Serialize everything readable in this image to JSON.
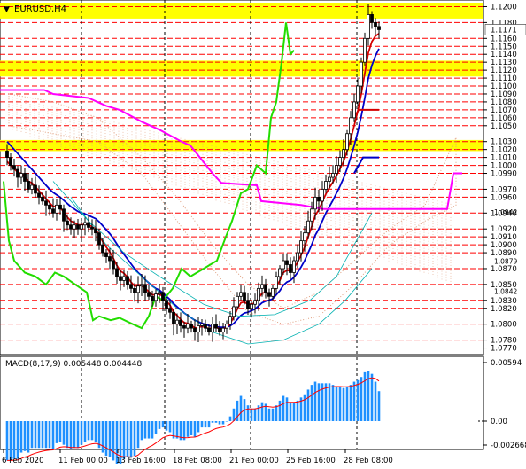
{
  "symbol_label": "EURUSD,H4",
  "macd_label": "MACD(8,17,9) 0.005448 0.004448",
  "colors": {
    "zone": "#ffff00",
    "level_line": "#ff0000",
    "candle": "#000000",
    "ma_red": "#d40000",
    "ma_blue": "#0000c8",
    "ma_magenta": "#ff00ff",
    "green_line": "#22dd00",
    "cyan": "#00b0b0",
    "ichimoku_cloud": "#e0a080",
    "macd_hist": "#1e90ff",
    "macd_signal": "#ff0000"
  },
  "chart_data": {
    "type": "candlestick",
    "symbol": "EURUSD",
    "timeframe": "H4",
    "ylim": [
      1.0765,
      1.1205
    ],
    "y_ticks": [
      "1.1200",
      "1.1180",
      "1.1160",
      "1.1150",
      "1.1140",
      "1.1130",
      "1.1120",
      "1.1110",
      "1.1100",
      "1.1090",
      "1.1080",
      "1.1070",
      "1.1060",
      "1.1050",
      "1.1030",
      "1.1020",
      "1.1010",
      "1.1000",
      "1.0990",
      "1.0970",
      "1.0960",
      "1.0940",
      "1.0920",
      "1.0910",
      "1.0900",
      "1.0890",
      "1.0870",
      "1.0850",
      "1.0830",
      "1.0820",
      "1.0800",
      "1.0780",
      "1.0770"
    ],
    "small_tick_labels": [
      "1.0879",
      "1.0942",
      "1.0842"
    ],
    "current_price": "1.1171",
    "x_labels": [
      "6 Feb 2020",
      "11 Feb 00:00",
      "13 Feb 16:00",
      "18 Feb 08:00",
      "21 Feb 00:00",
      "25 Feb 16:00",
      "28 Feb 08:00"
    ],
    "zones": [
      [
        1.1185,
        1.1205
      ],
      [
        1.1112,
        1.1132
      ],
      [
        1.1018,
        1.1032
      ]
    ],
    "levels": [
      1.12,
      1.118,
      1.116,
      1.115,
      1.114,
      1.113,
      1.112,
      1.111,
      1.11,
      1.109,
      1.108,
      1.107,
      1.106,
      1.105,
      1.103,
      1.102,
      1.101,
      1.1,
      1.099,
      1.097,
      1.096,
      1.094,
      1.092,
      1.091,
      1.09,
      1.089,
      1.087,
      1.085,
      1.083,
      1.082,
      1.08,
      1.078,
      1.077
    ],
    "closes": [
      1.101,
      1.1,
      1.0995,
      1.0985,
      1.099,
      1.098,
      1.097,
      1.0975,
      1.0965,
      1.096,
      1.0955,
      1.095,
      1.0945,
      1.094,
      1.095,
      1.0945,
      1.093,
      1.0925,
      1.092,
      1.0925,
      1.092,
      1.0925,
      1.0928,
      1.0922,
      1.092,
      1.0915,
      1.09,
      1.089,
      1.0885,
      1.088,
      1.087,
      1.086,
      1.0855,
      1.086,
      1.085,
      1.0845,
      1.084,
      1.0848,
      1.085,
      1.084,
      1.0835,
      1.083,
      1.0838,
      1.084,
      1.083,
      1.082,
      1.0815,
      1.08,
      1.0805,
      1.0798,
      1.0795,
      1.08,
      1.0795,
      1.079,
      1.0798,
      1.08,
      1.0795,
      1.079,
      1.08,
      1.0795,
      1.079,
      1.0795,
      1.08,
      1.081,
      1.0822,
      1.0835,
      1.084,
      1.083,
      1.082,
      1.0825,
      1.083,
      1.0845,
      1.085,
      1.084,
      1.0835,
      1.0845,
      1.086,
      1.087,
      1.088,
      1.0875,
      1.0865,
      1.088,
      1.089,
      1.0905,
      1.0915,
      1.093,
      1.0945,
      1.096,
      1.0955,
      1.097,
      1.098,
      1.0985,
      1.099,
      1.1,
      1.101,
      1.102,
      1.104,
      1.106,
      1.108,
      1.11,
      1.113,
      1.116,
      1.119,
      1.118,
      1.1175,
      1.1171
    ],
    "ma_red": [
      1.1005,
      1.1,
      1.0996,
      1.0991,
      1.099,
      1.0986,
      1.098,
      1.0978,
      1.0973,
      1.0968,
      1.0963,
      1.0958,
      1.0953,
      1.0948,
      1.0949,
      1.0947,
      1.0941,
      1.0935,
      1.093,
      1.0928,
      1.0925,
      1.0925,
      1.0926,
      1.0925,
      1.0923,
      1.092,
      1.0912,
      1.0904,
      1.0897,
      1.0891,
      1.0883,
      1.0874,
      1.0867,
      1.0864,
      1.0859,
      1.0853,
      1.0848,
      1.0848,
      1.0849,
      1.0845,
      1.0841,
      1.0837,
      1.0837,
      1.0838,
      1.0835,
      1.0829,
      1.0824,
      1.0815,
      1.0811,
      1.0806,
      1.0802,
      1.0801,
      1.0799,
      1.0795,
      1.0796,
      1.0797,
      1.0796,
      1.0794,
      1.0796,
      1.0796,
      1.0794,
      1.0794,
      1.0796,
      1.0801,
      1.0809,
      1.0819,
      1.0827,
      1.0828,
      1.0825,
      1.0825,
      1.0827,
      1.0833,
      1.0839,
      1.084,
      1.0838,
      1.084,
      1.0847,
      1.0855,
      1.0865,
      1.0868,
      1.0867,
      1.0871,
      1.0878,
      1.0887,
      1.0897,
      1.091,
      1.0923,
      1.0937,
      1.0944,
      1.0954,
      1.0964,
      1.0972,
      1.0979,
      1.0987,
      1.0996,
      1.1005,
      1.1018,
      1.1033,
      1.105,
      1.1068,
      1.109,
      1.1116,
      1.1142,
      1.1156,
      1.1163,
      1.1166
    ],
    "ma_blue": [
      1.103,
      1.1025,
      1.102,
      1.1015,
      1.101,
      1.1005,
      1.1,
      1.0995,
      1.099,
      1.0985,
      1.098,
      1.0975,
      1.097,
      1.0966,
      1.0963,
      1.096,
      1.0956,
      1.0952,
      1.0948,
      1.0945,
      1.0942,
      1.094,
      1.0939,
      1.0937,
      1.0935,
      1.0933,
      1.0929,
      1.0924,
      1.0919,
      1.0914,
      1.0908,
      1.0901,
      1.0894,
      1.0888,
      1.0882,
      1.0876,
      1.087,
      1.0865,
      1.0861,
      1.0856,
      1.0852,
      1.0848,
      1.0845,
      1.0843,
      1.0839,
      1.0835,
      1.0831,
      1.0826,
      1.0822,
      1.0818,
      1.0814,
      1.0811,
      1.0808,
      1.0805,
      1.0803,
      1.0801,
      1.08,
      1.0798,
      1.0797,
      1.0797,
      1.0796,
      1.0796,
      1.0796,
      1.0798,
      1.0801,
      1.0806,
      1.0811,
      1.0814,
      1.0815,
      1.0817,
      1.0819,
      1.0823,
      1.0827,
      1.0829,
      1.083,
      1.0832,
      1.0837,
      1.0842,
      1.0849,
      1.0853,
      1.0855,
      1.0859,
      1.0865,
      1.0872,
      1.088,
      1.089,
      1.09,
      1.0912,
      1.092,
      1.093,
      1.094,
      1.0948,
      1.0956,
      1.0965,
      1.0974,
      1.0984,
      1.0996,
      1.101,
      1.1025,
      1.1042,
      1.1062,
      1.1085,
      1.111,
      1.1126,
      1.1138,
      1.1147
    ]
  },
  "macd_ticks": [
    "0.00594",
    "0.00",
    "-0.002668"
  ]
}
